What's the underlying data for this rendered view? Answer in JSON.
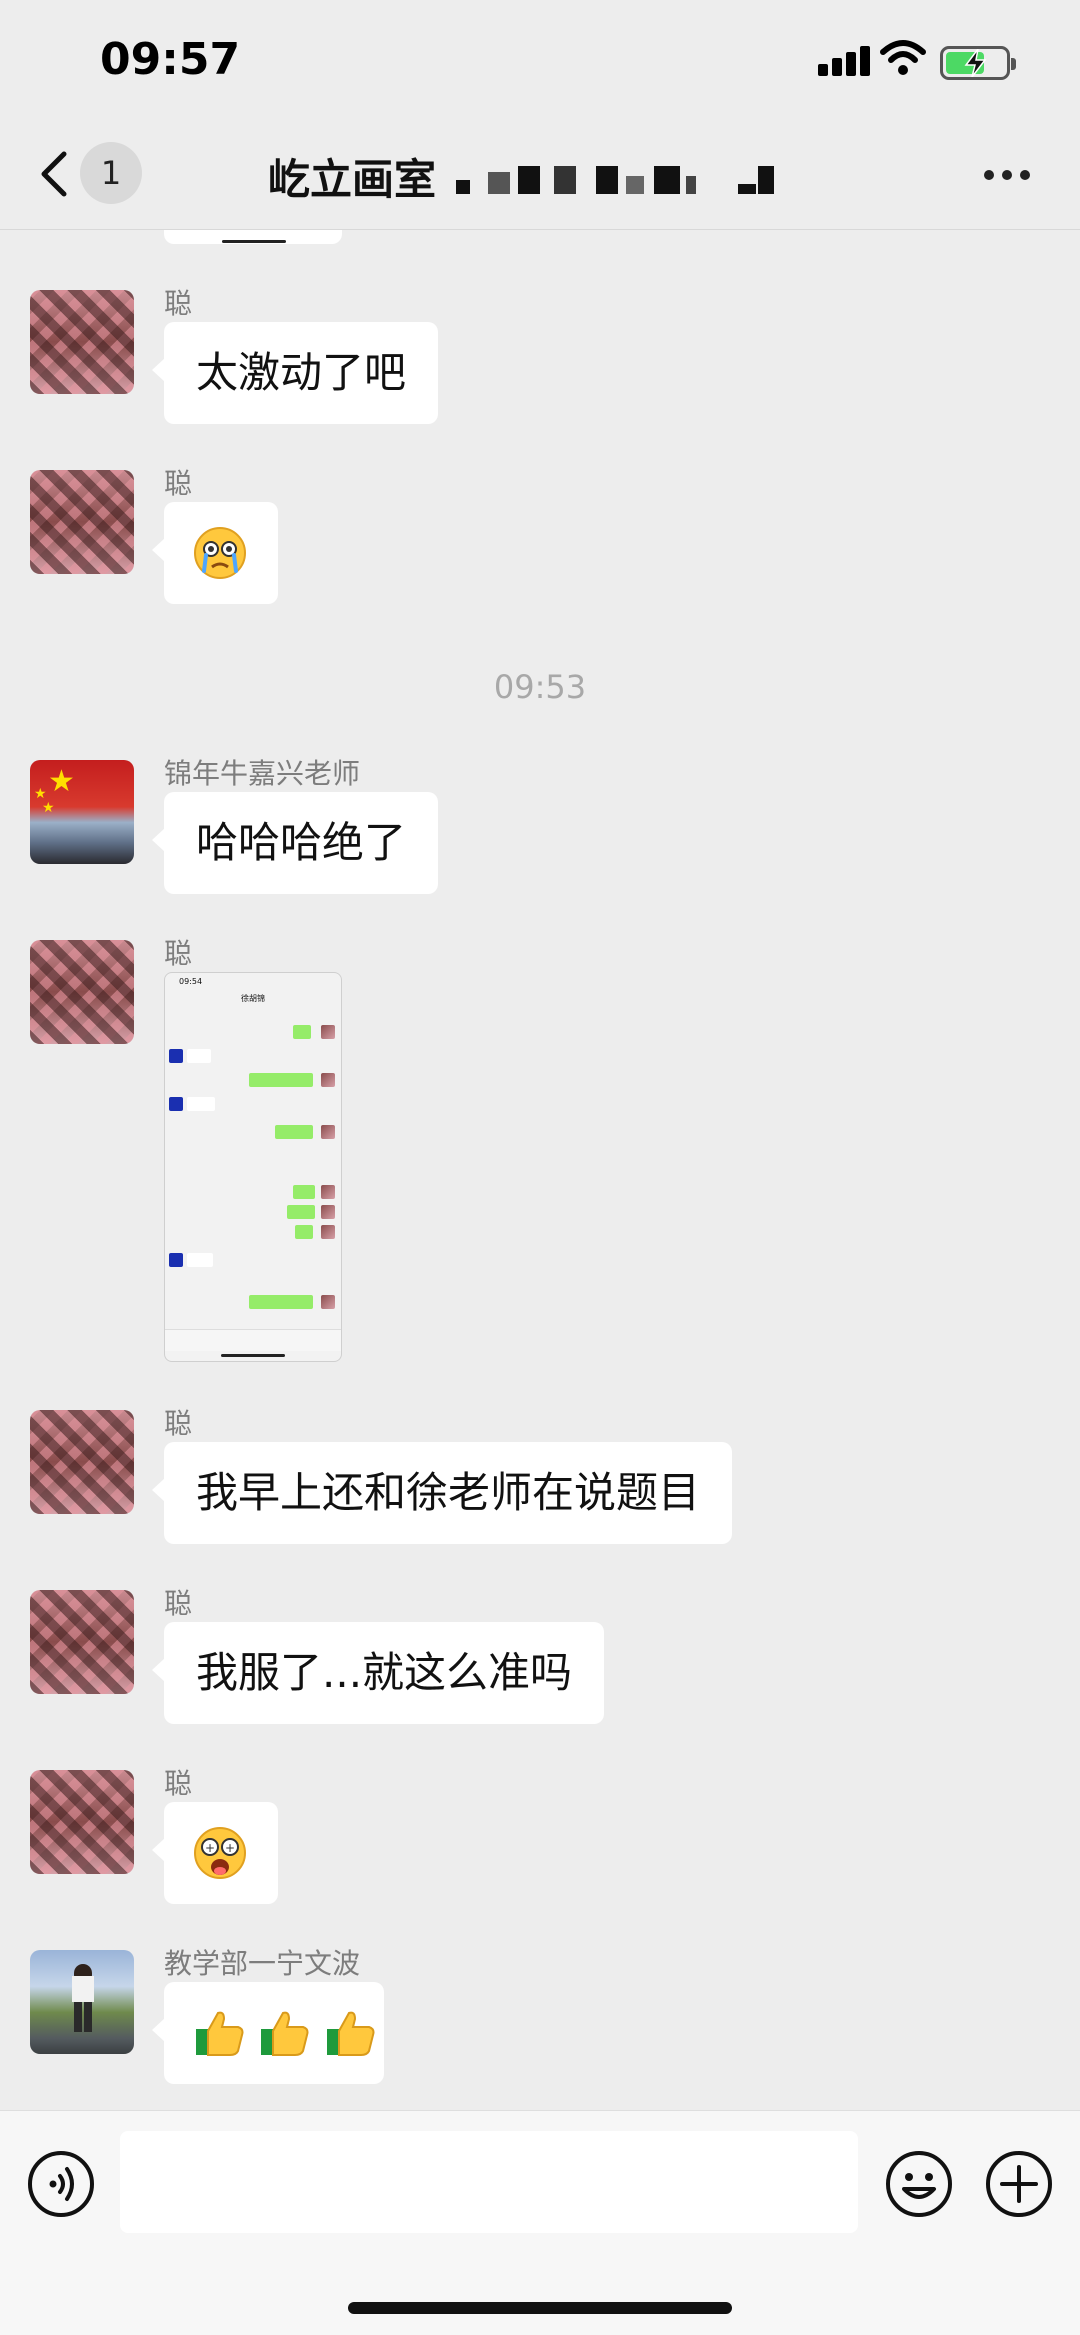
{
  "status_bar": {
    "time": "09:57"
  },
  "nav": {
    "back_count": "1",
    "title": "屹立画室"
  },
  "messages": [
    {
      "sender": "聪",
      "type": "text",
      "text": "太激动了吧"
    },
    {
      "sender": "聪",
      "type": "emoji",
      "emoji": "crying-face"
    },
    {
      "type": "time",
      "text": "09:53"
    },
    {
      "sender": "锦年牛嘉兴老师",
      "type": "text",
      "text": "哈哈哈绝了"
    },
    {
      "sender": "聪",
      "type": "image"
    },
    {
      "sender": "聪",
      "type": "text",
      "text": "我早上还和徐老师在说题目"
    },
    {
      "sender": "聪",
      "type": "text",
      "text": "我服了...就这么准吗"
    },
    {
      "sender": "聪",
      "type": "emoji",
      "emoji": "shocked-face"
    },
    {
      "sender": "教学部一宁文波",
      "type": "emoji",
      "emoji": "thumbs-up x3"
    }
  ],
  "image_preview": {
    "status_time": "09:54",
    "chat_title": "徐胡锦"
  },
  "colors": {
    "background": "#ededed",
    "bubble": "#ffffff",
    "sent_bubble": "#95ec69",
    "timestamp": "#a8a8a8"
  }
}
